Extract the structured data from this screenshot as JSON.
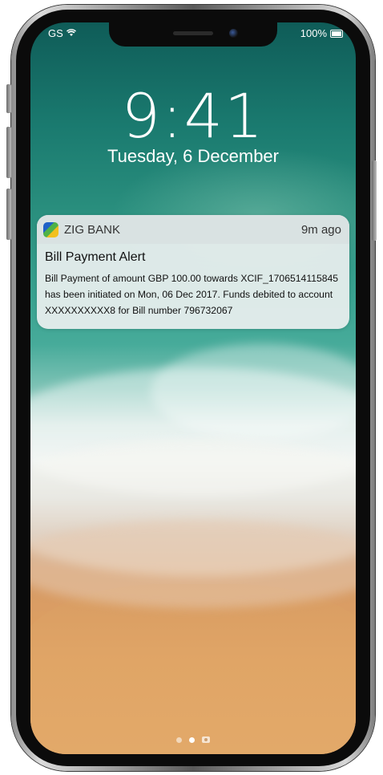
{
  "status_bar": {
    "carrier": "GS",
    "battery_text": "100%",
    "signal_icon": "wifi-icon",
    "battery_icon": "battery-icon"
  },
  "lock_screen": {
    "time": "9:41",
    "date": "Tuesday, 6 December"
  },
  "notification": {
    "app_name": "ZIG BANK",
    "app_icon": "zig-bank-logo-icon",
    "time_ago": "9m ago",
    "title": "Bill Payment Alert",
    "body": "Bill Payment of amount GBP 100.00 towards XCIF_1706514115845 has been initiated on Mon, 06 Dec 2017. Funds debited to account XXXXXXXXXX8 for Bill number 796732067"
  },
  "page_indicator": {
    "pages": [
      "dot",
      "dot-active",
      "camera-icon"
    ]
  },
  "colors": {
    "notification_bg": "#ecf0f0",
    "text_primary": "#111111",
    "lock_text": "#ffffff"
  }
}
